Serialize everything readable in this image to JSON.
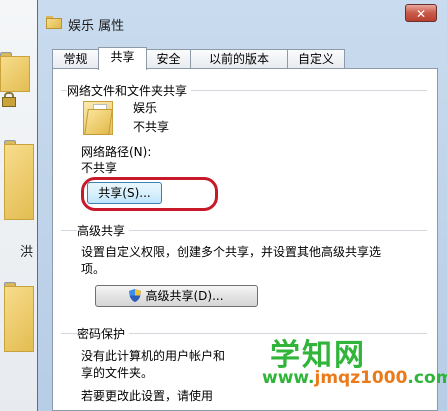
{
  "background": {
    "folder_label_partial": "洪"
  },
  "dialog": {
    "title": "娱乐 属性",
    "close_glyph": "✕",
    "tabs": [
      "常规",
      "共享",
      "安全",
      "以前的版本",
      "自定义"
    ],
    "active_tab": "共享",
    "network_share": {
      "group_title": "网络文件和文件夹共享",
      "folder_name": "娱乐",
      "folder_status": "不共享",
      "path_label": "网络路径(N):",
      "path_value": "不共享",
      "share_button": "共享(S)..."
    },
    "advanced_share": {
      "group_title": "高级共享",
      "description": "设置自定义权限，创建多个共享，并设置其他高级共享选项。",
      "button": "高级共享(D)..."
    },
    "password_protection": {
      "group_title": "密码保护",
      "line1": "没有此计算机的用户帐户和",
      "line2": "享的文件夹。",
      "line3": "若要更改此设置，请使用"
    }
  },
  "watermark": {
    "text": "学知网",
    "url_prefix": "www.",
    "url_main": "jmqz1000",
    "url_suffix": ".com"
  },
  "colors": {
    "highlight_ring": "#c8192a",
    "watermark_green": "#31b43a",
    "watermark_orange": "#ea7a1a"
  }
}
